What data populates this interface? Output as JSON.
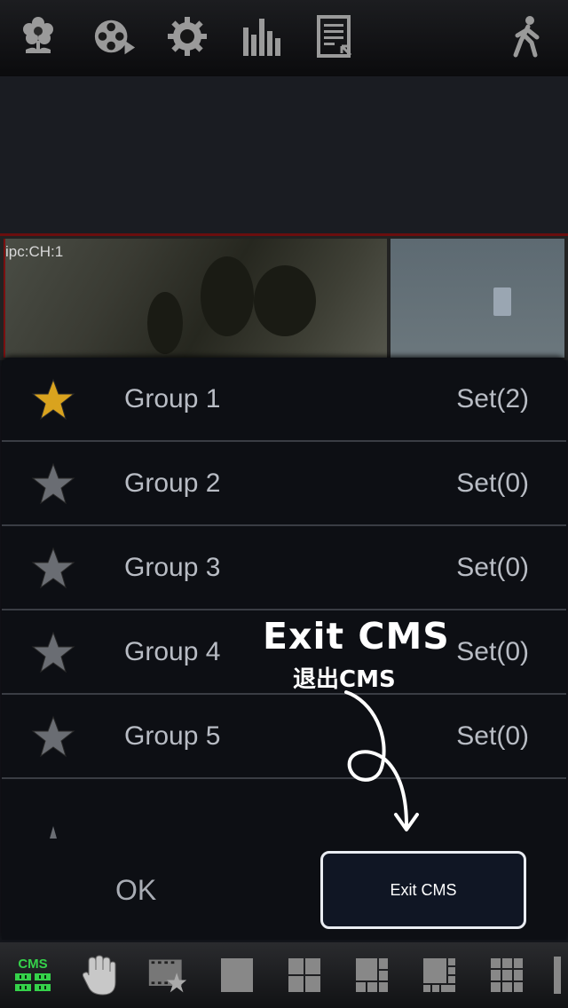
{
  "toolbar": {
    "icons": [
      "flower-icon",
      "film-reel-icon",
      "gear-icon",
      "bar-chart-icon",
      "document-icon",
      "walking-person-icon"
    ]
  },
  "video": {
    "channel_label": "ipc:CH:1"
  },
  "groups": [
    {
      "name": "Group 1",
      "set": "Set(2)",
      "active": true
    },
    {
      "name": "Group 2",
      "set": "Set(0)",
      "active": false
    },
    {
      "name": "Group 3",
      "set": "Set(0)",
      "active": false
    },
    {
      "name": "Group 4",
      "set": "Set(0)",
      "active": false
    },
    {
      "name": "Group 5",
      "set": "Set(0)",
      "active": false
    }
  ],
  "footer": {
    "ok_label": "OK",
    "exit_label": "Exit  CMS"
  },
  "hint": {
    "title": "Exit CMS",
    "subtitle": "退出CMS"
  },
  "bottombar": {
    "cms_label": "CMS",
    "icons": [
      "cms-icon",
      "hand-icon",
      "favorite-film-icon",
      "layout-1-icon",
      "layout-4-icon",
      "layout-6-icon",
      "layout-8-icon",
      "layout-9-icon"
    ]
  },
  "colors": {
    "accent_green": "#35d24a",
    "star_gold": "#d9a31e",
    "star_gray": "#6a6d73"
  }
}
